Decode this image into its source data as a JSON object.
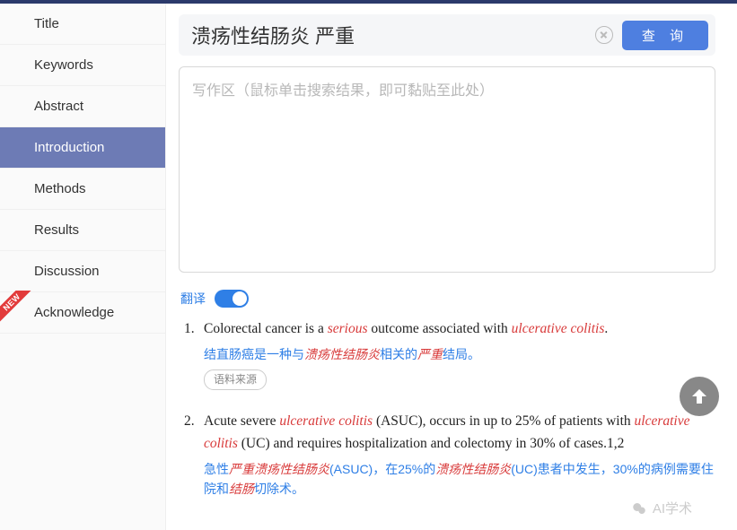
{
  "sidebar": {
    "items": [
      {
        "label": "Title",
        "active": false
      },
      {
        "label": "Keywords",
        "active": false
      },
      {
        "label": "Abstract",
        "active": false
      },
      {
        "label": "Introduction",
        "active": true
      },
      {
        "label": "Methods",
        "active": false
      },
      {
        "label": "Results",
        "active": false
      },
      {
        "label": "Discussion",
        "active": false
      },
      {
        "label": "Acknowledge",
        "active": false
      }
    ],
    "new_badge": "NEW"
  },
  "search": {
    "value": "溃疡性结肠炎 严重",
    "query_label": "查 询"
  },
  "writing": {
    "placeholder": "写作区（鼠标单击搜索结果，即可黏贴至此处）"
  },
  "translate": {
    "label": "翻译",
    "on": true
  },
  "source_tag": "语料来源",
  "results": [
    {
      "num": "1.",
      "en_parts": [
        {
          "t": "Colorectal cancer is a ",
          "h": false
        },
        {
          "t": "serious",
          "h": true
        },
        {
          "t": " outcome associated with ",
          "h": false
        },
        {
          "t": "ulcerative colitis",
          "h": true
        },
        {
          "t": ".",
          "h": false
        }
      ],
      "zh_parts": [
        {
          "t": "结直肠癌是一种与",
          "h": false
        },
        {
          "t": "溃疡性结肠炎",
          "h": true
        },
        {
          "t": "相关的",
          "h": false
        },
        {
          "t": "严重",
          "h": true
        },
        {
          "t": "结局。",
          "h": false
        }
      ],
      "show_source": true
    },
    {
      "num": "2.",
      "en_parts": [
        {
          "t": "Acute severe ",
          "h": false
        },
        {
          "t": "ulcerative colitis",
          "h": true
        },
        {
          "t": " (ASUC), occurs in up to 25% of patients with ",
          "h": false
        },
        {
          "t": "ulcerative colitis",
          "h": true
        },
        {
          "t": " (UC) and requires hospitalization and colectomy in 30% of cases.1,2",
          "h": false
        }
      ],
      "zh_parts": [
        {
          "t": "急性",
          "h": false
        },
        {
          "t": "严重溃疡性结肠炎",
          "h": true
        },
        {
          "t": "(ASUC)，在25%的",
          "h": false
        },
        {
          "t": "溃疡性结肠炎",
          "h": true
        },
        {
          "t": "(UC)患者中发生，30%的病例需要住院和",
          "h": false
        },
        {
          "t": "结肠",
          "h": true
        },
        {
          "t": "切除术。",
          "h": false
        }
      ],
      "show_source": false
    }
  ],
  "watermark": "AI学术"
}
